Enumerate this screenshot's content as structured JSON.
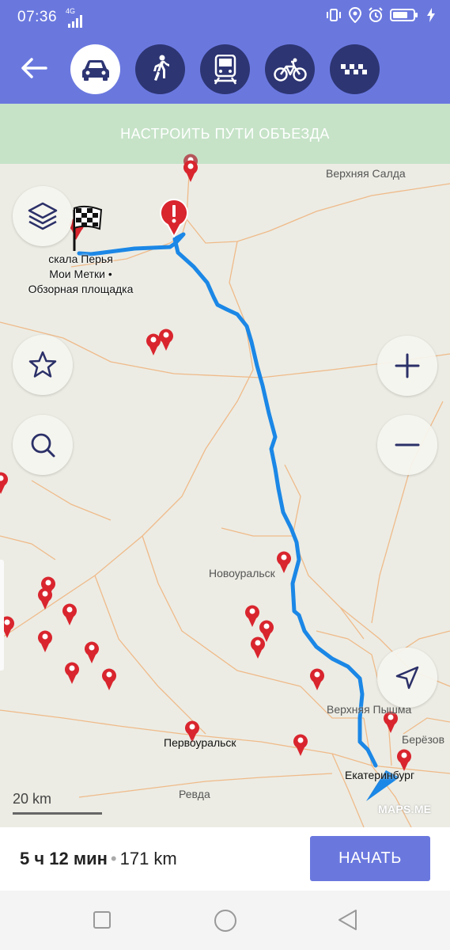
{
  "status_bar": {
    "time": "07:36",
    "network": "4G"
  },
  "header": {
    "back_icon": "arrow-left-icon",
    "modes": [
      {
        "id": "car",
        "icon": "car-icon",
        "active": true
      },
      {
        "id": "walk",
        "icon": "pedestrian-icon",
        "active": false
      },
      {
        "id": "transit",
        "icon": "train-icon",
        "active": false
      },
      {
        "id": "bike",
        "icon": "bicycle-icon",
        "active": false
      },
      {
        "id": "taxi",
        "icon": "taxi-icon",
        "active": false
      }
    ]
  },
  "detour_banner": {
    "label": "НАСТРОИТЬ ПУТИ ОБЪЕЗДА"
  },
  "map": {
    "destination": {
      "line1": "скала Перья",
      "line2": "Мои Метки •",
      "line3": "Обзорная площадка"
    },
    "places": {
      "verkhnyaya_salda": "Верхняя Салда",
      "novouralsk": "Новоуральск",
      "verkhnyaya_pyshma": "Верхняя Пышма",
      "beryozovsky": "Берёзов",
      "pervouralsk": "Первоуральск",
      "revda": "Ревда",
      "ekaterinburg": "Екатеринбург"
    },
    "scale": "20 km",
    "watermark": "MAPS.ME",
    "colors": {
      "route": "#1b87e6",
      "pin": "#d9252e",
      "roads": "#f0a862"
    }
  },
  "bottom": {
    "duration": "5 ч 12 мин",
    "separator": "•",
    "distance": "171 km",
    "start_label": "НАЧАТЬ"
  }
}
